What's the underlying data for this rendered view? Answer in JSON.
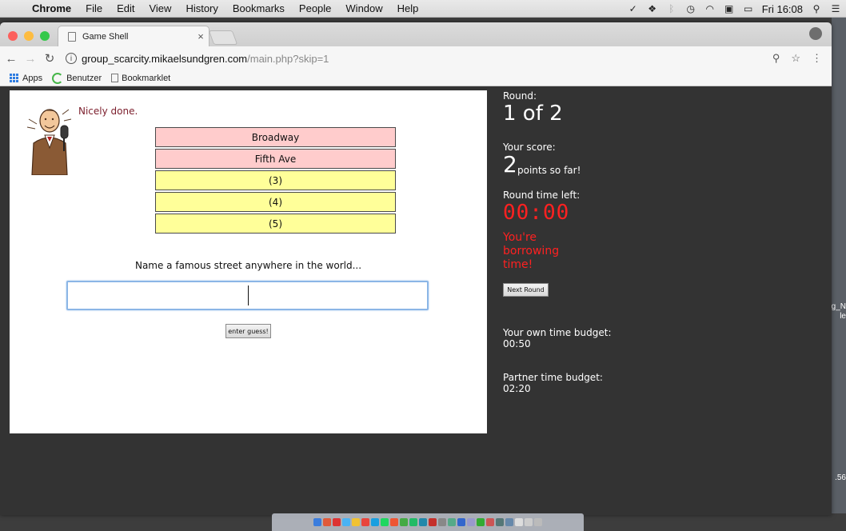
{
  "menubar": {
    "app": "Chrome",
    "items": [
      "File",
      "Edit",
      "View",
      "History",
      "Bookmarks",
      "People",
      "Window",
      "Help"
    ],
    "clock": "Fri 16:08"
  },
  "tab": {
    "title": "Game Shell",
    "close": "×"
  },
  "address": {
    "host": "group_scarcity.mikaelsundgren.com",
    "path": "/main.php?skip=1",
    "info": "i"
  },
  "bookmarks": {
    "apps": "Apps",
    "benutzer": "Benutzer",
    "bookmarklet": "Bookmarklet"
  },
  "game": {
    "feedback": "Nicely done.",
    "answers": [
      {
        "label": "Broadway",
        "state": "found"
      },
      {
        "label": "Fifth Ave",
        "state": "found"
      },
      {
        "label": "(3)",
        "state": "open"
      },
      {
        "label": "(4)",
        "state": "open"
      },
      {
        "label": "(5)",
        "state": "open"
      }
    ],
    "prompt": "Name a famous street anywhere in the world...",
    "guess_value": "",
    "enter_label": "enter guess!"
  },
  "sidebar": {
    "round_label": "Round:",
    "round_value": "1 of 2",
    "score_label": "Your score:",
    "score_value": "2",
    "score_suffix": "points so far!",
    "time_label": "Round time left:",
    "time_value": "00:00",
    "warning": "You're borrowing time!",
    "next_label": "Next Round",
    "own_budget_label": "Your own time budget:",
    "own_budget_value": "00:50",
    "partner_budget_label": "Partner time budget:",
    "partner_budget_value": "02:20"
  },
  "desktop": {
    "label1": "g_N",
    "label2": "le",
    "label3": ".56"
  },
  "colors": {
    "found_bg": "#ffcccc",
    "open_bg": "#ffff99",
    "warning": "#ff2121",
    "feedback": "#7b1d2b",
    "page_bg": "#333333"
  }
}
